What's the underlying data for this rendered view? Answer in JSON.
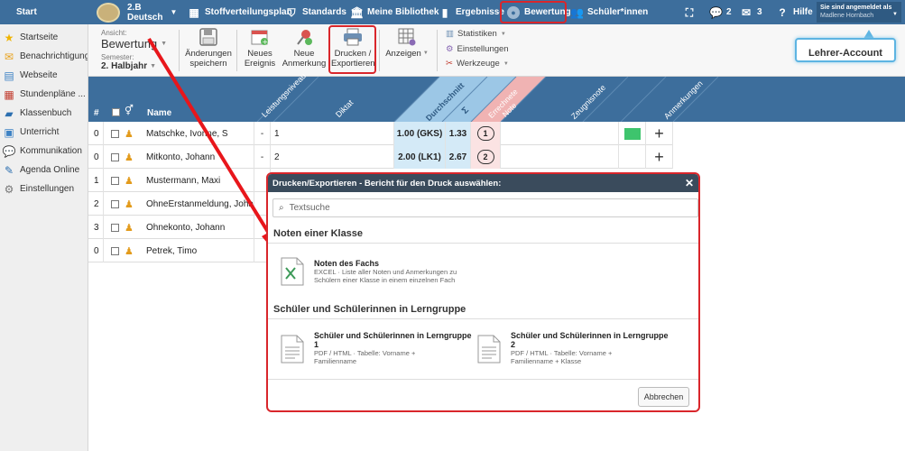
{
  "topbar": {
    "start": "Start",
    "class_name": "2.B",
    "subject": "Deutsch",
    "nav": [
      "Stoffverteilungsplan",
      "Standards",
      "Meine Bibliothek",
      "Ergebnisse",
      "Bewertung",
      "Schüler*innen"
    ],
    "chat_count": "2",
    "mail_count": "3",
    "help": "Hilfe",
    "logged_in_label": "Sie sind angemeldet als",
    "user_name": "Madlene Hornbach"
  },
  "tooltip": "Lehrer-Account",
  "sidebar": {
    "items": [
      "Startseite",
      "Benachrichtigungen",
      "Webseite",
      "Stundenpläne ...",
      "Klassenbuch",
      "Unterricht",
      "Kommunikation",
      "Agenda Online",
      "Einstellungen"
    ]
  },
  "ribbon": {
    "view_label": "Ansicht:",
    "view_value": "Bewertung",
    "semester_label": "Semester:",
    "semester_value": "2. Halbjahr",
    "save": "Änderungen speichern",
    "new_event": "Neues Ereignis",
    "new_note": "Neue Anmerkung",
    "print_export": "Drucken / Exportieren",
    "show": "Anzeigen",
    "stats": "Statistiken",
    "settings": "Einstellungen",
    "tools": "Werkzeuge"
  },
  "table": {
    "headers": {
      "hash": "#",
      "name": "Name",
      "level": "Leistungsniveau",
      "diktat": "Diktat",
      "avg": "Durchschnitt",
      "sigma": "Σ",
      "calc": "Errechnete Note",
      "report": "Zeugnisnote",
      "notes": "Anmerkungen"
    },
    "rows": [
      {
        "num": "0",
        "name": "Matschke, Ivonne, S",
        "level": "-",
        "diktat": "1",
        "avg": "1.00 (GKS)",
        "sigma": "1.33",
        "grade": "1"
      },
      {
        "num": "0",
        "name": "Mitkonto, Johann",
        "level": "-",
        "diktat": "2",
        "avg": "2.00 (LK1)",
        "sigma": "2.67",
        "grade": "2"
      },
      {
        "num": "1",
        "name": "Mustermann, Maxi",
        "level": "",
        "diktat": "",
        "avg": "",
        "sigma": "",
        "grade": ""
      },
      {
        "num": "2",
        "name": "OhneErstanmeldung, Johann",
        "level": "",
        "diktat": "",
        "avg": "",
        "sigma": "",
        "grade": ""
      },
      {
        "num": "3",
        "name": "Ohnekonto, Johann",
        "level": "",
        "diktat": "",
        "avg": "",
        "sigma": "",
        "grade": ""
      },
      {
        "num": "0",
        "name": "Petrek, Timo",
        "level": "",
        "diktat": "",
        "avg": "",
        "sigma": "",
        "grade": ""
      }
    ]
  },
  "dialog": {
    "title": "Drucken/Exportieren - Bericht für den Druck auswählen:",
    "search_placeholder": "Textsuche",
    "section1": "Noten einer Klasse",
    "item1_title": "Noten des Fachs",
    "item1_desc": "EXCEL · Liste aller Noten und Anmerkungen zu Schülern einer Klasse in einem einzelnen Fach",
    "section2": "Schüler und Schülerinnen in Lerngruppe",
    "item2_title": "Schüler und Schülerinnen in Lerngruppe 1",
    "item2_desc": "PDF / HTML · Tabelle: Vorname + Familienname",
    "item3_title": "Schüler und Schülerinnen in Lerngruppe 2",
    "item3_desc": "PDF / HTML · Tabelle: Vorname + Familienname + Klasse",
    "cancel": "Abbrechen"
  },
  "colors": {
    "topbar": "#3d6e9c",
    "highlight": "#d9262b",
    "avg_bg": "#d4eaf7",
    "calc_bg": "#fbe3e3",
    "green": "#3ec46d"
  }
}
